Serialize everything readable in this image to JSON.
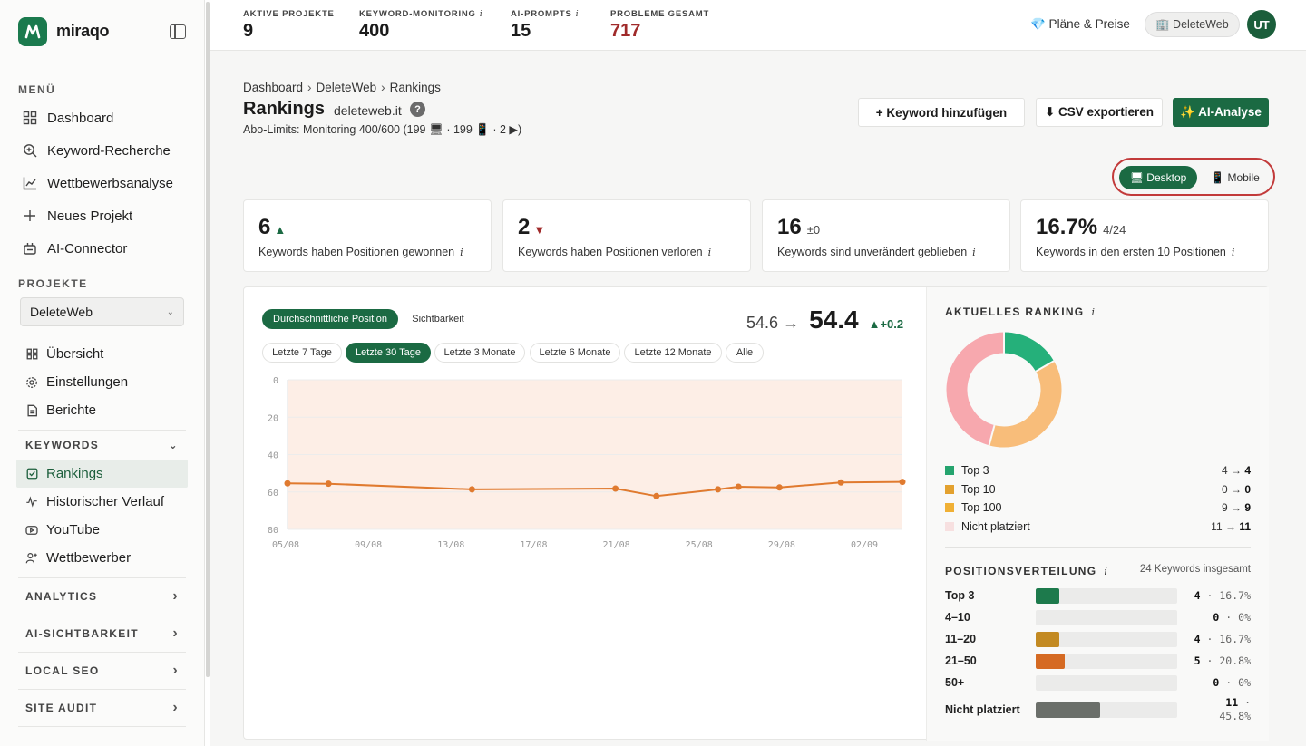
{
  "app": {
    "name": "miraqo"
  },
  "sidebar": {
    "menu_title": "MENÜ",
    "menu": [
      {
        "label": "Dashboard",
        "icon": "grid-icon"
      },
      {
        "label": "Keyword-Recherche",
        "icon": "search-plus-icon"
      },
      {
        "label": "Wettbewerbsanalyse",
        "icon": "line-chart-icon"
      },
      {
        "label": "Neues Projekt",
        "icon": "plus-icon"
      },
      {
        "label": "AI-Connector",
        "icon": "connector-icon"
      }
    ],
    "projects_title": "PROJEKTE",
    "project_selected": "DeleteWeb",
    "project_items": [
      {
        "label": "Übersicht",
        "icon": "grid-small-icon"
      },
      {
        "label": "Einstellungen",
        "icon": "gear-icon"
      },
      {
        "label": "Berichte",
        "icon": "document-icon"
      }
    ],
    "keywords_title": "KEYWORDS",
    "keyword_items": [
      {
        "label": "Rankings",
        "icon": "checkbox-icon",
        "active": true
      },
      {
        "label": "Historischer Verlauf",
        "icon": "pulse-icon"
      },
      {
        "label": "YouTube",
        "icon": "youtube-icon"
      },
      {
        "label": "Wettbewerber",
        "icon": "users-icon"
      }
    ],
    "groups": [
      "ANALYTICS",
      "AI-SICHTBARKEIT",
      "LOCAL SEO",
      "SITE AUDIT"
    ]
  },
  "topbar": {
    "stats": [
      {
        "label": "AKTIVE PROJEKTE",
        "value": "9",
        "info": false
      },
      {
        "label": "KEYWORD-MONITORING",
        "value": "400",
        "info": true
      },
      {
        "label": "AI-PROMPTS",
        "value": "15",
        "info": true
      },
      {
        "label": "PROBLEME GESAMT",
        "value": "717",
        "info": false,
        "color": "#a02a2a"
      }
    ],
    "plans_label": "💎 Pläne & Preise",
    "workspace_label": "🏢 DeleteWeb",
    "avatar_initials": "UT"
  },
  "page": {
    "breadcrumb": [
      "Dashboard",
      "DeleteWeb",
      "Rankings"
    ],
    "title": "Rankings",
    "domain": "deleteweb.it",
    "limits": "Abo-Limits: Monitoring 400/600 (199 🖥 · 199 📱 · 2 ▶)",
    "buttons": {
      "add_keyword": "+ Keyword hinzufügen",
      "export_csv": "⬇ CSV exportieren",
      "ai_analysis": "✨ AI-Analyse"
    },
    "device": {
      "desktop": "🖥 Desktop",
      "mobile": "📱 Mobile",
      "selected": "desktop"
    }
  },
  "cards": [
    {
      "value": "6",
      "aux": "▲",
      "aux_type": "up",
      "text": "Keywords haben Positionen gewonnen"
    },
    {
      "value": "2",
      "aux": "▼",
      "aux_type": "down",
      "text": "Keywords haben Positionen verloren"
    },
    {
      "value": "16",
      "aux": "±0",
      "aux_type": "neutral",
      "text": "Keywords sind unverändert geblieben"
    },
    {
      "value": "16.7%",
      "aux": "4/24",
      "aux_type": "neutral",
      "text": "Keywords in den ersten 10 Positionen"
    }
  ],
  "chart_panel": {
    "metric_tabs": [
      "Durchschnittliche Position",
      "Sichtbarkeit"
    ],
    "metric_selected": 0,
    "ranges": [
      "Letzte 7 Tage",
      "Letzte 30 Tage",
      "Letzte 3 Monate",
      "Letzte 6 Monate",
      "Letzte 12 Monate",
      "Alle"
    ],
    "range_selected": 1,
    "avg_from": "54.6",
    "avg_arrow": "→",
    "avg_to": "54.4",
    "avg_delta": "▲+0.2"
  },
  "chart_data": {
    "type": "line",
    "x": [
      "05/08",
      "09/08",
      "13/08",
      "17/08",
      "21/08",
      "25/08",
      "29/08",
      "02/09"
    ],
    "points": [
      {
        "x": "05/08",
        "y": 55.4
      },
      {
        "x": "07/08",
        "y": 55.6
      },
      {
        "x": "14/08",
        "y": 58.6
      },
      {
        "x": "21/08",
        "y": 58.2
      },
      {
        "x": "23/08",
        "y": 62.2
      },
      {
        "x": "26/08",
        "y": 58.6
      },
      {
        "x": "27/08",
        "y": 57.2
      },
      {
        "x": "29/08",
        "y": 57.6
      },
      {
        "x": "01/09",
        "y": 54.9
      },
      {
        "x": "04/09",
        "y": 54.6
      }
    ],
    "y_ticks": [
      "0",
      "20",
      "40",
      "60",
      "80"
    ],
    "ylim": [
      0,
      80
    ],
    "y_reversed": true,
    "series_color": "#e07a2f",
    "area_color": "#fdeee6"
  },
  "ranking": {
    "title": "AKTUELLES RANKING",
    "donut": [
      {
        "label": "Top 3",
        "value": 4,
        "color": "#25b07a"
      },
      {
        "label": "Top 10",
        "value": 0,
        "color": "#e9a23b"
      },
      {
        "label": "Top 100",
        "value": 9,
        "color": "#f8bd7a"
      },
      {
        "label": "Nicht platziert",
        "value": 11,
        "color": "#f7a8ae"
      }
    ],
    "legend": [
      {
        "label": "Top 3",
        "from": "4",
        "to": "4",
        "color": "#25a46e"
      },
      {
        "label": "Top 10",
        "from": "0",
        "to": "0",
        "color": "#e3a12e"
      },
      {
        "label": "Top 100",
        "from": "9",
        "to": "9",
        "color": "#f0b035"
      },
      {
        "label": "Nicht platziert",
        "from": "11",
        "to": "11",
        "color": "#f7e0e0"
      }
    ]
  },
  "distribution": {
    "title": "POSITIONSVERTEILUNG",
    "total": "24 Keywords insgesamt",
    "rows": [
      {
        "label": "Top 3",
        "count": "4",
        "pct": "16.7%",
        "fraction": 0.167,
        "color": "#1d7a4c"
      },
      {
        "label": "4–10",
        "count": "0",
        "pct": "0%",
        "fraction": 0,
        "color": "#1d7a4c"
      },
      {
        "label": "11–20",
        "count": "4",
        "pct": "16.7%",
        "fraction": 0.167,
        "color": "#c38a22"
      },
      {
        "label": "21–50",
        "count": "5",
        "pct": "20.8%",
        "fraction": 0.208,
        "color": "#d56a23"
      },
      {
        "label": "50+",
        "count": "0",
        "pct": "0%",
        "fraction": 0,
        "color": "#888"
      },
      {
        "label": "Nicht platziert",
        "count": "11",
        "pct": "45.8%",
        "fraction": 0.458,
        "color": "#6b6f6a"
      }
    ]
  }
}
